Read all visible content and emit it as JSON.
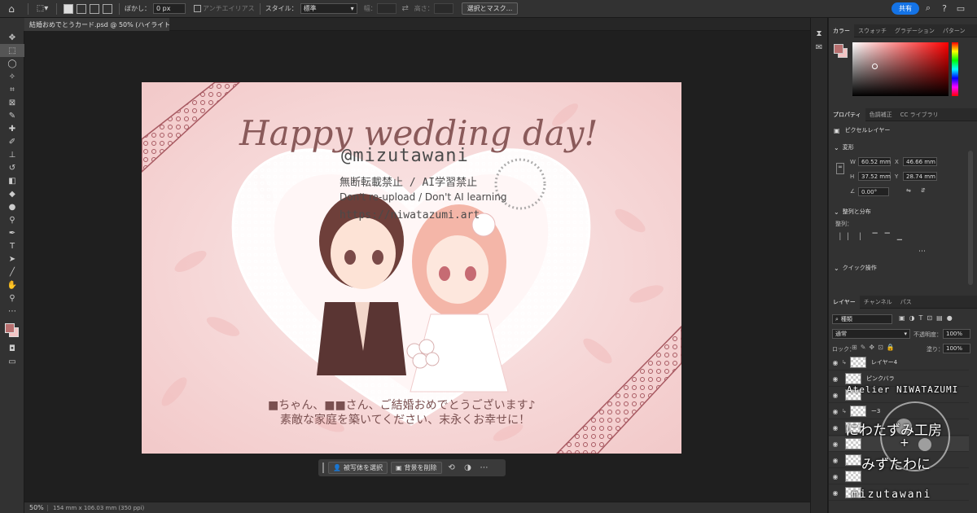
{
  "options_bar": {
    "feather_label": "ぼかし：",
    "feather_value": "0 px",
    "antialias_label": "アンチエイリアス",
    "style_label": "スタイル：",
    "style_value": "標準",
    "width_label": "幅：",
    "height_label": "高さ：",
    "select_mask_button": "選択とマスク...",
    "share_button": "共有"
  },
  "document": {
    "tab_title": "結婚おめでとうカード.psd @ 50% (ハイライト, RGB/8)",
    "zoom": "50%",
    "dimensions": "154 mm x 106.03 mm (350 ppi)"
  },
  "artwork": {
    "title": "Happy wedding day!",
    "watermark_handle": "@mizutawani",
    "watermark_jp": "無断転載禁止 / AI学習禁止",
    "watermark_en": "Don't re-upload / Don't AI learning",
    "watermark_url": "https://niwatazumi.art",
    "message_line1": "■ちゃん、■■さん、ご結婚おめでとうございます♪",
    "message_line2": "素敵な家庭を築いてください、末永くお幸せに！"
  },
  "context_bar": {
    "select_subject": "被写体を選択",
    "remove_background": "背景を削除"
  },
  "color_panel": {
    "tabs": [
      "カラー",
      "スウォッチ",
      "グラデーション",
      "パターン"
    ],
    "foreground": "#b86f6f",
    "background": "#f4c5c5"
  },
  "properties_panel": {
    "tabs": [
      "プロパティ",
      "色調補正",
      "CC ライブラリ"
    ],
    "layer_type": "ピクセルレイヤー",
    "transform_label": "変形",
    "w_label": "W",
    "w_value": "60.52 mm",
    "h_label": "H",
    "h_value": "37.52 mm",
    "x_label": "X",
    "x_value": "46.66 mm",
    "y_label": "Y",
    "y_value": "28.74 mm",
    "angle_value": "0.00°",
    "align_label": "整列と分布",
    "align_sub": "整列：",
    "quick_actions": "クイック操作"
  },
  "layers_panel": {
    "tabs": [
      "レイヤー",
      "チャンネル",
      "パス"
    ],
    "filter_kind": "種類",
    "blend_mode": "通常",
    "opacity_label": "不透明度：",
    "opacity_value": "100%",
    "lock_label": "ロック：",
    "fill_label": "塗り：",
    "fill_value": "100%",
    "layers": [
      {
        "name": "レイヤー4"
      },
      {
        "name": "ピンクバラ"
      },
      {
        "name": ""
      },
      {
        "name": "ー3"
      },
      {
        "name": ""
      },
      {
        "name": ""
      },
      {
        "name": ""
      },
      {
        "name": ""
      },
      {
        "name": ""
      }
    ]
  },
  "atelier_watermark": {
    "line1": "Atelier NIWATAZUMI",
    "line2": "にわたずみ工房",
    "line3": "+",
    "line4": "みずたわに",
    "line5": "mizutawani"
  }
}
